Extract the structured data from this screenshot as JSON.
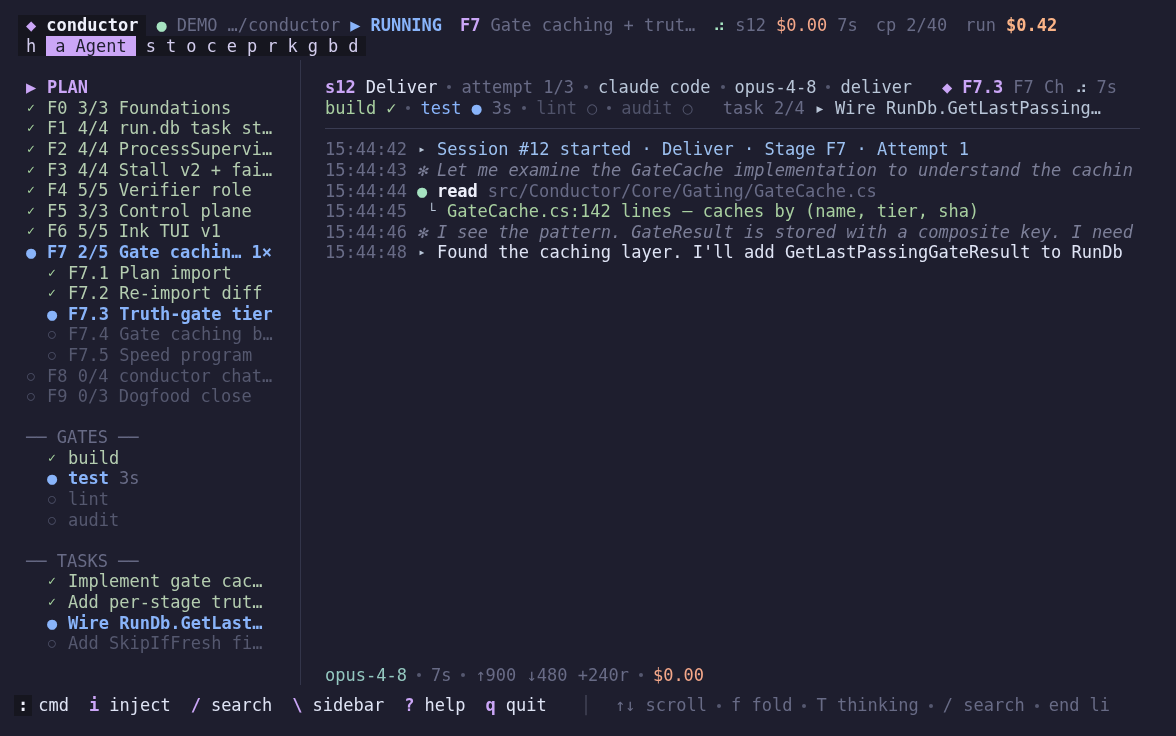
{
  "header": {
    "brand_icon": "◆",
    "brand": "conductor",
    "demo_icon": "●",
    "demo": "DEMO",
    "path": "…/conductor",
    "state_icon": "▶",
    "state": "RUNNING",
    "stage": "F7",
    "stage_title": "Gate caching + trut…",
    "spinner": "⠴",
    "session": "s12",
    "session_cost": "$0.00",
    "elapsed": "7s",
    "checkpoint": "cp 2/40",
    "run_label": "run",
    "run_cost": "$0.42"
  },
  "tabs": [
    {
      "key": "h",
      "selected": false
    },
    {
      "key": "a",
      "label": "Agent",
      "selected": true
    },
    {
      "key": "s",
      "selected": false
    },
    {
      "key": "t",
      "selected": false
    },
    {
      "key": "o",
      "selected": false
    },
    {
      "key": "c",
      "selected": false
    },
    {
      "key": "e",
      "selected": false
    },
    {
      "key": "p",
      "selected": false
    },
    {
      "key": "r",
      "selected": false
    },
    {
      "key": "k",
      "selected": false
    },
    {
      "key": "g",
      "selected": false
    },
    {
      "key": "b",
      "selected": false
    },
    {
      "key": "d",
      "selected": false
    }
  ],
  "sidebar": {
    "plan": {
      "icon": "▶",
      "label": "PLAN",
      "items": [
        {
          "icon": "✓",
          "done": true,
          "running": false,
          "id": "F0",
          "count": "3/3",
          "title": "Foundations"
        },
        {
          "icon": "✓",
          "done": true,
          "running": false,
          "id": "F1",
          "count": "4/4",
          "title": "run.db task st…"
        },
        {
          "icon": "✓",
          "done": true,
          "running": false,
          "id": "F2",
          "count": "4/4",
          "title": "ProcessSupervi…"
        },
        {
          "icon": "✓",
          "done": true,
          "running": false,
          "id": "F3",
          "count": "4/4",
          "title": "Stall v2 + fai…"
        },
        {
          "icon": "✓",
          "done": true,
          "running": false,
          "id": "F4",
          "count": "5/5",
          "title": "Verifier role"
        },
        {
          "icon": "✓",
          "done": true,
          "running": false,
          "id": "F5",
          "count": "3/3",
          "title": "Control plane"
        },
        {
          "icon": "✓",
          "done": true,
          "running": false,
          "id": "F6",
          "count": "5/5",
          "title": "Ink TUI v1"
        },
        {
          "icon": "●",
          "done": false,
          "running": true,
          "id": "F7",
          "count": "2/5",
          "title": "Gate cachin…",
          "badge": "1×",
          "children": [
            {
              "icon": "✓",
              "done": true,
              "running": false,
              "id": "F7.1",
              "title": "Plan import"
            },
            {
              "icon": "✓",
              "done": true,
              "running": false,
              "id": "F7.2",
              "title": "Re-import diff"
            },
            {
              "icon": "●",
              "done": false,
              "running": true,
              "id": "F7.3",
              "title": "Truth-gate tier"
            },
            {
              "icon": "○",
              "done": false,
              "running": false,
              "id": "F7.4",
              "title": "Gate caching b…"
            },
            {
              "icon": "○",
              "done": false,
              "running": false,
              "id": "F7.5",
              "title": "Speed program"
            }
          ]
        },
        {
          "icon": "○",
          "done": false,
          "running": false,
          "id": "F8",
          "count": "0/4",
          "title": "conductor chat…"
        },
        {
          "icon": "○",
          "done": false,
          "running": false,
          "id": "F9",
          "count": "0/3",
          "title": "Dogfood close"
        }
      ]
    },
    "gates": {
      "heading": "── GATES ──",
      "items": [
        {
          "icon": "✓",
          "done": true,
          "running": false,
          "name": "build"
        },
        {
          "icon": "●",
          "done": false,
          "running": true,
          "name": "test",
          "time": "3s"
        },
        {
          "icon": "○",
          "done": false,
          "running": false,
          "name": "lint"
        },
        {
          "icon": "○",
          "done": false,
          "running": false,
          "name": "audit"
        }
      ]
    },
    "tasks": {
      "heading": "── TASKS ──",
      "items": [
        {
          "icon": "✓",
          "done": true,
          "running": false,
          "name": "Implement gate cac…"
        },
        {
          "icon": "✓",
          "done": true,
          "running": false,
          "name": "Add per-stage trut…"
        },
        {
          "icon": "●",
          "done": false,
          "running": true,
          "name": "Wire RunDb.GetLast…"
        },
        {
          "icon": "○",
          "done": false,
          "running": false,
          "name": "Add SkipIfFresh fi…"
        }
      ]
    }
  },
  "session_bar": {
    "session": "s12",
    "stage": "Deliver",
    "details": [
      "attempt 1/3",
      "claude code",
      "opus-4-8",
      "deliver"
    ],
    "task_icon": "◆",
    "task_id": "F7.3",
    "task_title": "F7 Ch",
    "spinner": "⠴",
    "elapsed": "7s"
  },
  "gate_bar": {
    "gates": [
      {
        "name": "build",
        "icon": "✓",
        "done": true,
        "running": false
      },
      {
        "name": "test",
        "icon": "●",
        "time": "3s",
        "done": false,
        "running": true
      },
      {
        "name": "lint",
        "icon": "○",
        "done": false,
        "running": false
      },
      {
        "name": "audit",
        "icon": "○",
        "done": false,
        "running": false
      }
    ],
    "task_count": "task 2/4",
    "task_icon": "▸",
    "task_title": "Wire RunDb.GetLastPassing…"
  },
  "log": [
    {
      "time": "15:44:42",
      "marker": "▸",
      "kind": "session",
      "text": "Session #12 started · Deliver · Stage F7 · Attempt 1"
    },
    {
      "time": "15:44:43",
      "marker": "✻",
      "kind": "thinking",
      "text": "Let me examine the GateCache implementation to understand the cachin"
    },
    {
      "time": "15:44:44",
      "marker": "●",
      "kind": "tool",
      "tool": "read",
      "text": "src/Conductor/Core/Gating/GateCache.cs"
    },
    {
      "time": "15:44:45",
      "marker": "└",
      "kind": "result",
      "text": "GateCache.cs:142 lines — caches by (name, tier, sha)"
    },
    {
      "time": "15:44:46",
      "marker": "✻",
      "kind": "thinking",
      "text": "I see the pattern. GateResult is stored with a composite key. I need"
    },
    {
      "time": "15:44:48",
      "marker": "▸",
      "kind": "message",
      "text": "Found the caching layer. I'll add GetLastPassingGateResult to RunDb"
    }
  ],
  "status_line": {
    "model": "opus-4-8",
    "details": [
      "7s",
      "↑900 ↓480 +240r"
    ],
    "cost": "$0.00"
  },
  "keys": [
    {
      "key": ":",
      "label": "cmd",
      "highlighted": true
    },
    {
      "key": "i",
      "label": "inject",
      "highlighted": false
    },
    {
      "key": "/",
      "label": "search",
      "highlighted": false
    },
    {
      "key": "\\",
      "label": "sidebar",
      "highlighted": false
    },
    {
      "key": "?",
      "label": "help",
      "highlighted": false
    },
    {
      "key": "q",
      "label": "quit",
      "highlighted": false
    }
  ],
  "key_divider": "│",
  "hints": [
    "↑↓ scroll",
    "f fold",
    "T thinking",
    "/ search",
    "end li"
  ]
}
